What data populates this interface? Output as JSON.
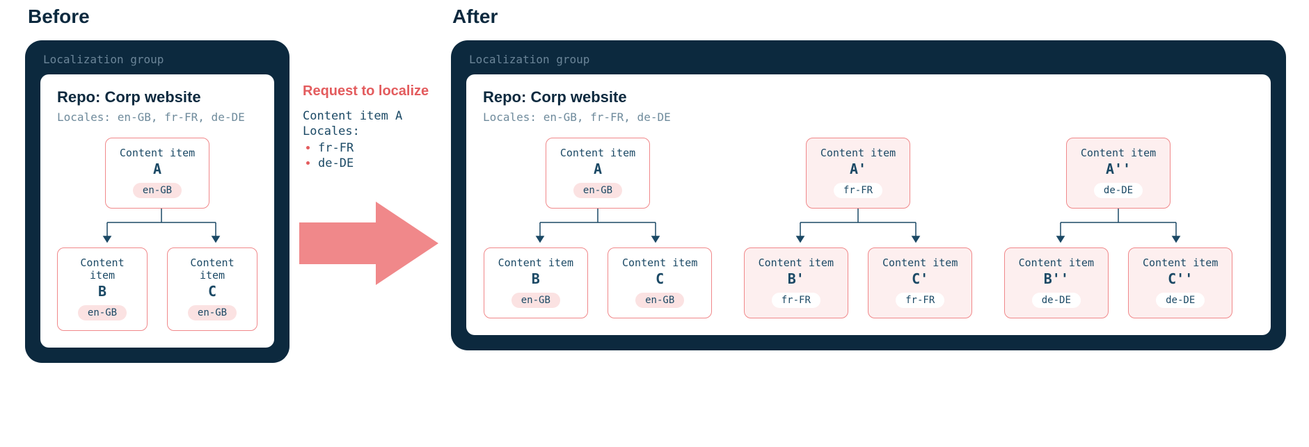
{
  "headings": {
    "before": "Before",
    "after": "After"
  },
  "group_label": "Localization group",
  "repo": {
    "title": "Repo: Corp website",
    "locales_line": "Locales: en-GB, fr-FR, de-DE"
  },
  "content_item_label": "Content item",
  "before_tree": {
    "parent": {
      "id": "A",
      "locale": "en-GB"
    },
    "children": [
      {
        "id": "B",
        "locale": "en-GB"
      },
      {
        "id": "C",
        "locale": "en-GB"
      }
    ]
  },
  "request": {
    "title": "Request to localize",
    "item_line": "Content item A",
    "locales_label": "Locales:",
    "locales": [
      "fr-FR",
      "de-DE"
    ]
  },
  "after_trees": [
    {
      "filled": false,
      "parent": {
        "id": "A",
        "locale": "en-GB"
      },
      "children": [
        {
          "id": "B",
          "locale": "en-GB"
        },
        {
          "id": "C",
          "locale": "en-GB"
        }
      ]
    },
    {
      "filled": true,
      "parent": {
        "id": "A'",
        "locale": "fr-FR"
      },
      "children": [
        {
          "id": "B'",
          "locale": "fr-FR"
        },
        {
          "id": "C'",
          "locale": "fr-FR"
        }
      ]
    },
    {
      "filled": true,
      "parent": {
        "id": "A''",
        "locale": "de-DE"
      },
      "children": [
        {
          "id": "B''",
          "locale": "de-DE"
        },
        {
          "id": "C''",
          "locale": "de-DE"
        }
      ]
    }
  ]
}
